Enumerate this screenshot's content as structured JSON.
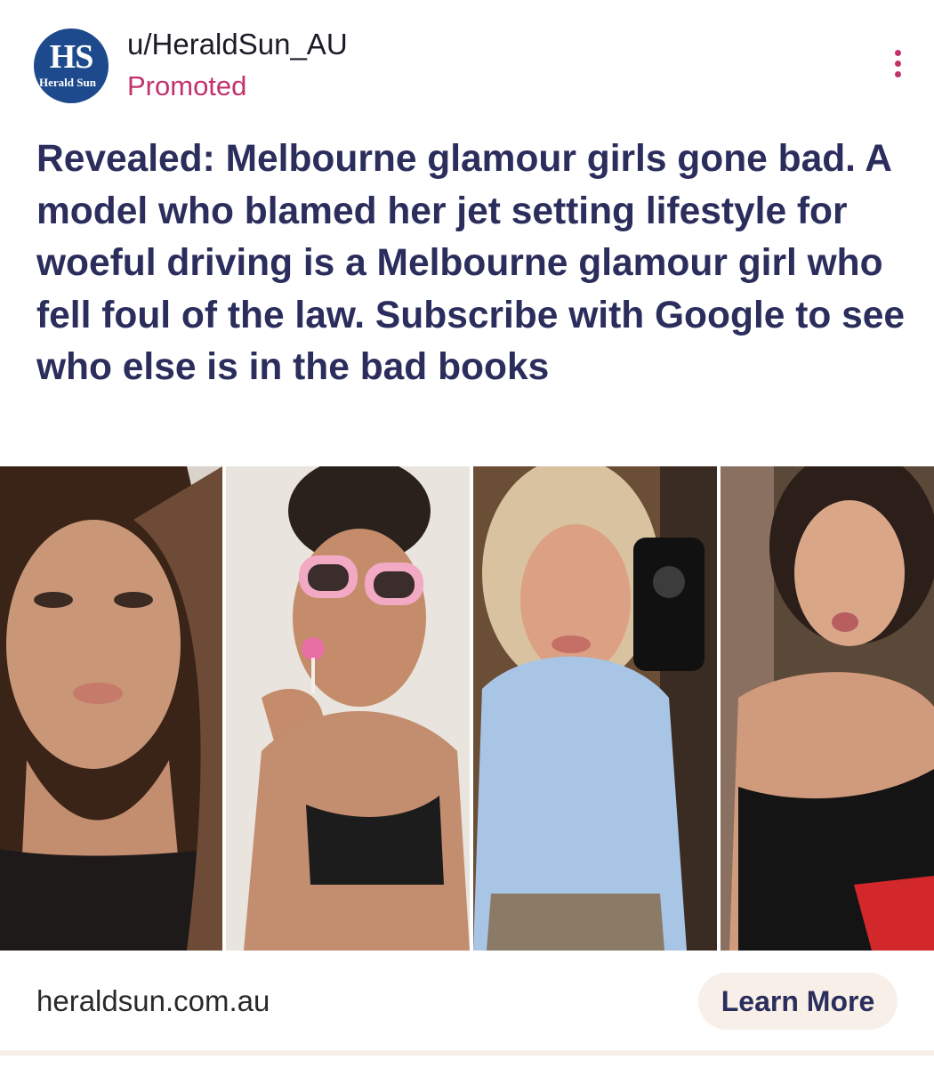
{
  "post": {
    "username": "u/HeraldSun_AU",
    "label": "Promoted",
    "avatar": {
      "initials": "HS",
      "subtext": "Herald Sun"
    },
    "headline": "Revealed: Melbourne glamour girls gone bad. A model who blamed her jet setting lifestyle for woeful driving is a Melbourne glamour girl who fell foul of the law. Subscribe with Google to see who else is in the bad books",
    "domain": "heraldsun.com.au",
    "cta_label": "Learn More",
    "more_icon": "kebab-menu-icon"
  },
  "colors": {
    "brand_blue": "#1d4a8c",
    "promoted_pink": "#c2336b",
    "headline_navy": "#2b2e5c",
    "cta_background": "#f7efe8"
  }
}
